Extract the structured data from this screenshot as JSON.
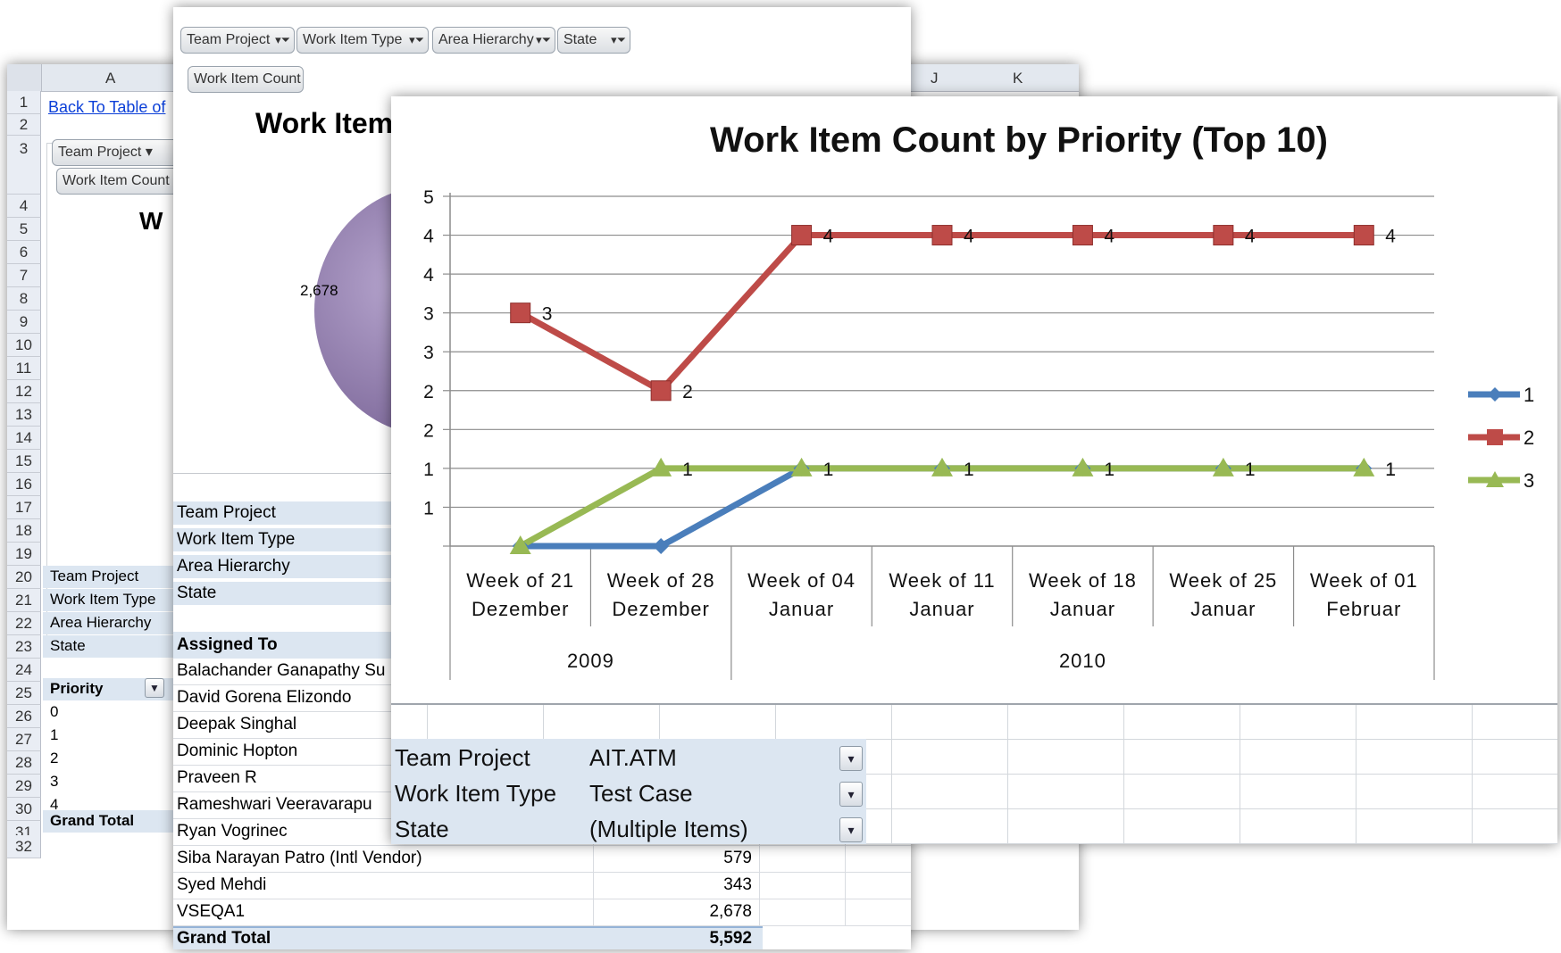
{
  "back_sheet": {
    "col_a": "A",
    "col_j": "J",
    "col_k": "K",
    "rows": [
      "1",
      "2",
      "3",
      "4",
      "5",
      "6",
      "7",
      "8",
      "9",
      "10",
      "11",
      "12",
      "13",
      "14",
      "15",
      "16",
      "17",
      "18",
      "19",
      "20",
      "21",
      "22",
      "23",
      "24",
      "25",
      "26",
      "27",
      "28",
      "29",
      "30",
      "31",
      "32"
    ],
    "link": "Back To Table of",
    "team_project_btn": "Team Project",
    "work_item_count_btn": "Work Item Count",
    "title_partial": "W",
    "filter_labels": [
      "Team Project",
      "Work Item Type",
      "Area Hierarchy",
      "State"
    ],
    "priority_header": "Priority",
    "priority_values": [
      "0",
      "1",
      "2",
      "3",
      "4"
    ],
    "grand_total": "Grand Total"
  },
  "middle_sheet": {
    "field_buttons": [
      "Team Project",
      "Work Item Type",
      "Area Hierarchy",
      "State"
    ],
    "value_button": "Work Item Count",
    "chart_title_partial": "Work Item",
    "pie_label": "2,678",
    "filter_labels": [
      "Team Project",
      "Work Item Type",
      "Area Hierarchy",
      "State"
    ],
    "assigned_header": "Assigned To",
    "assignees": [
      {
        "name": "Balachander Ganapathy Su",
        "value": ""
      },
      {
        "name": "David Gorena Elizondo",
        "value": ""
      },
      {
        "name": "Deepak Singhal",
        "value": ""
      },
      {
        "name": "Dominic Hopton",
        "value": ""
      },
      {
        "name": "Praveen R",
        "value": ""
      },
      {
        "name": "Rameshwari Veeravarapu",
        "value": ""
      },
      {
        "name": "Ryan Vogrinec",
        "value": ""
      },
      {
        "name": "Siba Narayan Patro (Intl Vendor)",
        "value": "579"
      },
      {
        "name": "Syed Mehdi",
        "value": "343"
      },
      {
        "name": "VSEQA1",
        "value": "2,678"
      }
    ],
    "grand_total_label": "Grand Total",
    "grand_total_value": "5,592"
  },
  "front_chart": {
    "filters": [
      {
        "label": "Team Project",
        "value": "AIT.ATM"
      },
      {
        "label": "Work Item Type",
        "value": "Test Case"
      },
      {
        "label": "State",
        "value": "(Multiple Items)"
      }
    ]
  },
  "chart_data": {
    "type": "line",
    "title": "Work Item Count by Priority (Top 10)",
    "x": [
      {
        "week": "Week of 21",
        "month": "Dezember"
      },
      {
        "week": "Week of 28",
        "month": "Dezember"
      },
      {
        "week": "Week of 04",
        "month": "Januar"
      },
      {
        "week": "Week of 11",
        "month": "Januar"
      },
      {
        "week": "Week of 18",
        "month": "Januar"
      },
      {
        "week": "Week of 25",
        "month": "Januar"
      },
      {
        "week": "Week of 01",
        "month": "Februar"
      }
    ],
    "years": [
      {
        "label": "2009",
        "span": [
          0,
          1
        ]
      },
      {
        "label": "2010",
        "span": [
          2,
          6
        ]
      }
    ],
    "y_tick_labels": [
      "",
      "1",
      "1",
      "2",
      "2",
      "3",
      "3",
      "4",
      "4",
      "5"
    ],
    "ylim": [
      0,
      4.5
    ],
    "grid": true,
    "legend_position": "right",
    "series": [
      {
        "name": "1",
        "color": "#4a7ebb",
        "marker": "diamond",
        "values": [
          0,
          0,
          1,
          1,
          1,
          1,
          1
        ],
        "labels": [
          "",
          "",
          "",
          "",
          "",
          "",
          "1"
        ]
      },
      {
        "name": "2",
        "color": "#be4b48",
        "marker": "square",
        "values": [
          3,
          2,
          4,
          4,
          4,
          4,
          4
        ],
        "labels": [
          "3",
          "2",
          "4",
          "4",
          "4",
          "4",
          "4"
        ]
      },
      {
        "name": "3",
        "color": "#98b954",
        "marker": "triangle",
        "values": [
          0,
          1,
          1,
          1,
          1,
          1,
          1
        ],
        "labels": [
          "",
          "1",
          "1",
          "1",
          "1",
          "1",
          "1"
        ]
      }
    ]
  }
}
